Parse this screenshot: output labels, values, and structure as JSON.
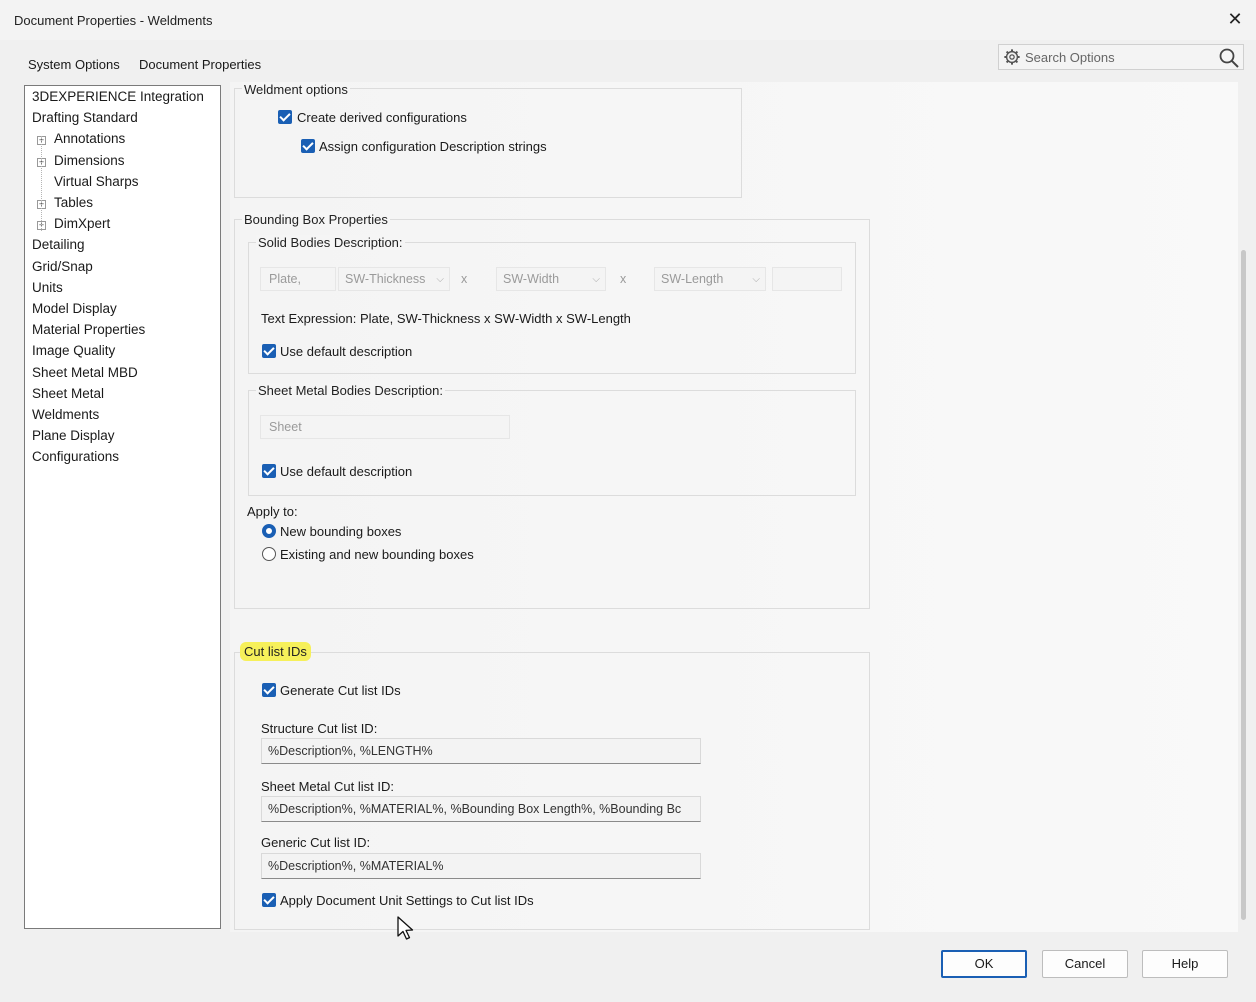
{
  "window": {
    "title": "Document Properties - Weldments",
    "close_label": "✕"
  },
  "tabs": [
    {
      "label": "System Options",
      "active": false
    },
    {
      "label": "Document Properties",
      "active": true
    }
  ],
  "search": {
    "placeholder": "Search Options",
    "icon": "gear-icon"
  },
  "tree": {
    "items": [
      {
        "label": "3DEXPERIENCE Integration",
        "indent": 0,
        "expandable": false
      },
      {
        "label": "Drafting Standard",
        "indent": 0,
        "expandable": false
      },
      {
        "label": "Annotations",
        "indent": 1,
        "expandable": true
      },
      {
        "label": "Dimensions",
        "indent": 1,
        "expandable": true
      },
      {
        "label": "Virtual Sharps",
        "indent": 1,
        "expandable": false
      },
      {
        "label": "Tables",
        "indent": 1,
        "expandable": true
      },
      {
        "label": "DimXpert",
        "indent": 1,
        "expandable": true
      },
      {
        "label": "Detailing",
        "indent": 0,
        "expandable": false
      },
      {
        "label": "Grid/Snap",
        "indent": 0,
        "expandable": false
      },
      {
        "label": "Units",
        "indent": 0,
        "expandable": false
      },
      {
        "label": "Model Display",
        "indent": 0,
        "expandable": false
      },
      {
        "label": "Material Properties",
        "indent": 0,
        "expandable": false
      },
      {
        "label": "Image Quality",
        "indent": 0,
        "expandable": false
      },
      {
        "label": "Sheet Metal MBD",
        "indent": 0,
        "expandable": false
      },
      {
        "label": "Sheet Metal",
        "indent": 0,
        "expandable": false
      },
      {
        "label": "Weldments",
        "indent": 0,
        "expandable": false,
        "selected": true
      },
      {
        "label": "Plane Display",
        "indent": 0,
        "expandable": false
      },
      {
        "label": "Configurations",
        "indent": 0,
        "expandable": false
      }
    ]
  },
  "weldment_options": {
    "title": "Weldment options",
    "create_derived": {
      "label": "Create derived configurations",
      "checked": true
    },
    "assign_description": {
      "label": "Assign configuration Description strings",
      "checked": true
    }
  },
  "bounding_box": {
    "title": "Bounding Box Properties",
    "solid": {
      "title": "Solid Bodies Description:",
      "prefix": "Plate,",
      "thickness": "SW-Thickness",
      "sep1": "x",
      "width": "SW-Width",
      "sep2": "x",
      "length": "SW-Length",
      "text_expression": "Text Expression: Plate, SW-Thickness x SW-Width x SW-Length",
      "use_default": {
        "label": "Use default description",
        "checked": true
      }
    },
    "sheet_metal": {
      "title": "Sheet Metal Bodies Description:",
      "value": "Sheet",
      "use_default": {
        "label": "Use default description",
        "checked": true
      }
    },
    "apply_to": {
      "label": "Apply to:",
      "new_boxes": {
        "label": "New bounding boxes",
        "selected": true
      },
      "existing_new": {
        "label": "Existing and new bounding boxes",
        "selected": false
      }
    }
  },
  "cut_list": {
    "title": "Cut list IDs",
    "generate": {
      "label": "Generate Cut list IDs",
      "checked": true
    },
    "structure": {
      "label": "Structure Cut list ID:",
      "value": "%Description%, %LENGTH%"
    },
    "sheet_metal": {
      "label": "Sheet Metal Cut list ID:",
      "value": "%Description%, %MATERIAL%, %Bounding Box Length%, %Bounding Bc"
    },
    "generic": {
      "label": "Generic Cut list ID:",
      "value": "%Description%, %MATERIAL%"
    },
    "apply_units": {
      "label": "Apply Document Unit Settings to Cut list IDs",
      "checked": true
    }
  },
  "buttons": {
    "ok": "OK",
    "cancel": "Cancel",
    "help": "Help"
  },
  "colors": {
    "accent": "#1a5fb4",
    "highlight": "#f6f05a"
  }
}
